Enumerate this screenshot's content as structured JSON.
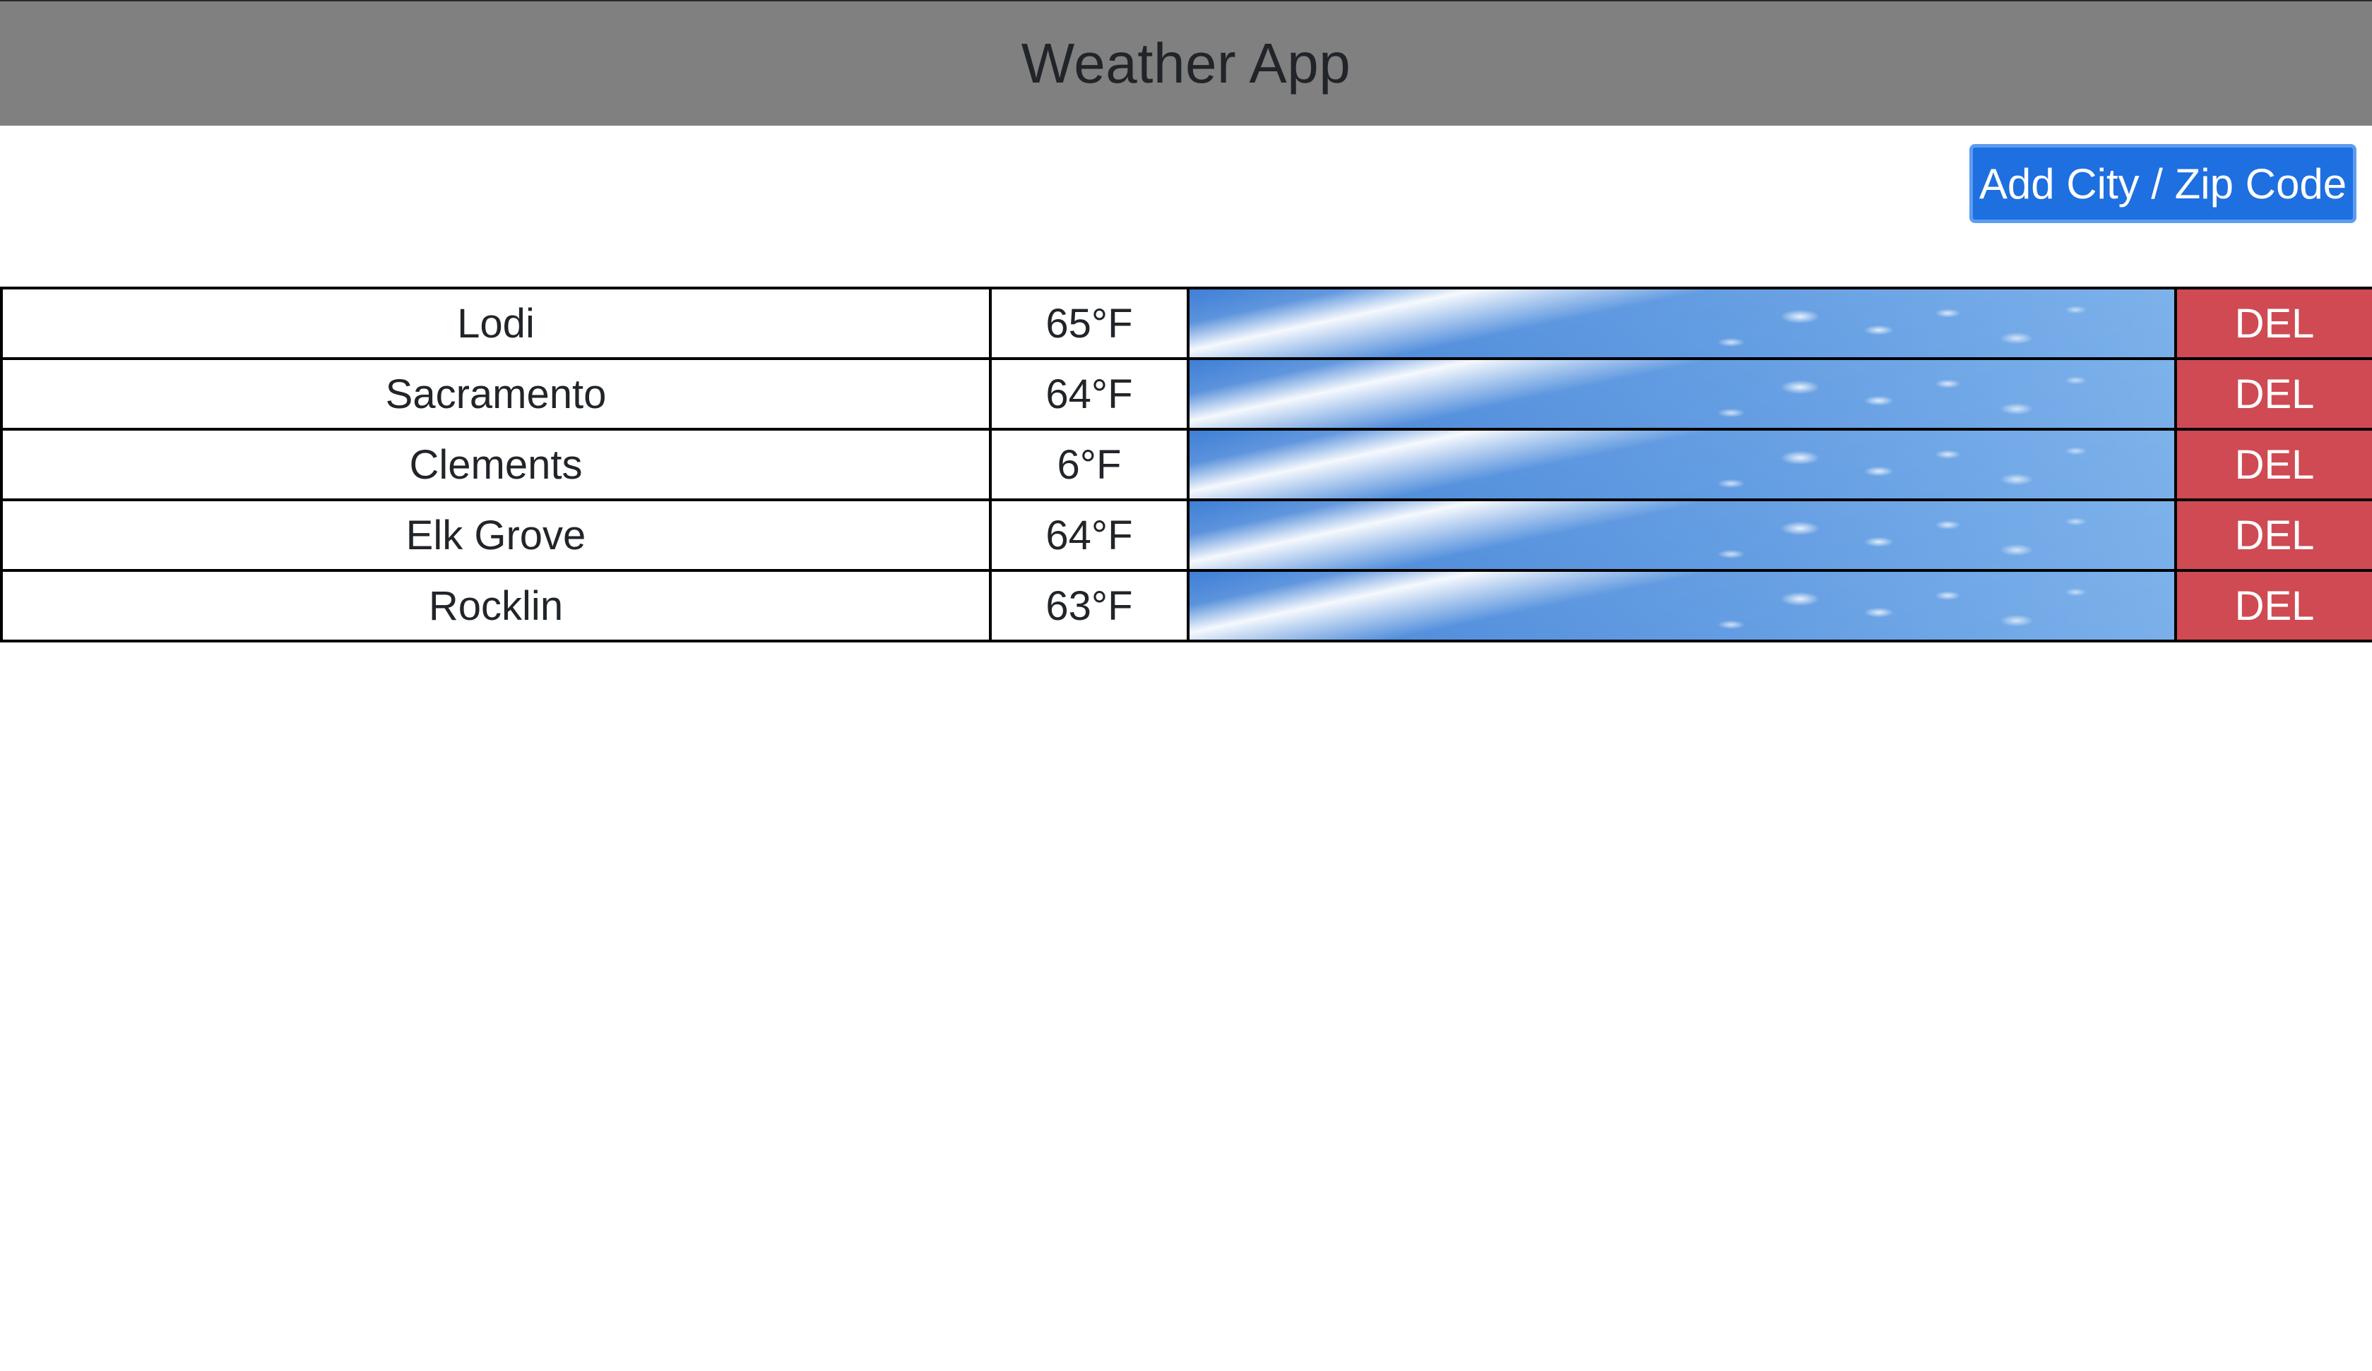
{
  "header": {
    "title": "Weather App",
    "background": "#808080"
  },
  "toolbar": {
    "add_label": "Add City / Zip Code",
    "add_color": "#1e6fe0"
  },
  "cities": [
    {
      "name": "Lodi",
      "temp": "65°F",
      "image": "sky-image",
      "delete_label": "DEL"
    },
    {
      "name": "Sacramento",
      "temp": "64°F",
      "image": "sky-image",
      "delete_label": "DEL"
    },
    {
      "name": "Clements",
      "temp": "6°F",
      "image": "sky-image",
      "delete_label": "DEL"
    },
    {
      "name": "Elk Grove",
      "temp": "64°F",
      "image": "sky-image",
      "delete_label": "DEL"
    },
    {
      "name": "Rocklin",
      "temp": "63°F",
      "image": "sky-image",
      "delete_label": "DEL"
    }
  ],
  "colors": {
    "delete": "#cf4a52",
    "sky": "#4f8edc"
  }
}
